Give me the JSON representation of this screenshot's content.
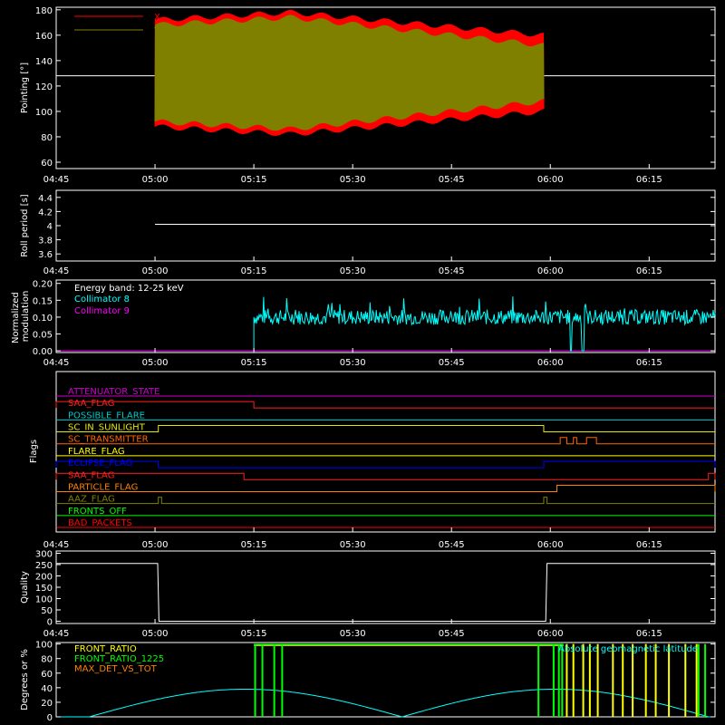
{
  "chart_data": [
    {
      "id": "pointing",
      "type": "line",
      "ylabel": "Pointing [°]",
      "ylim": [
        55,
        182
      ],
      "yticks": [
        60,
        80,
        100,
        120,
        140,
        160,
        180
      ],
      "xticks": [
        "04:45",
        "05:00",
        "05:15",
        "05:30",
        "05:45",
        "06:00",
        "06:15"
      ],
      "xlim_min": [
        -15,
        85
      ],
      "reference_line": 128,
      "series": [
        {
          "name": "X",
          "color": "#ff0000",
          "t_start": 0,
          "t_end": 59,
          "center": 130,
          "amp_start": 42,
          "amp_peak": 48,
          "amp_end": 30
        },
        {
          "name": "Y",
          "color": "#808000",
          "t_start": 0,
          "t_end": 59,
          "center": 130,
          "amp_start": 38,
          "amp_peak": 44,
          "amp_end": 22
        }
      ]
    },
    {
      "id": "roll",
      "type": "line",
      "ylabel": "Roll period [s]",
      "ylim": [
        3.5,
        4.5
      ],
      "yticks": [
        3.6,
        3.8,
        4.0,
        4.2,
        4.4
      ],
      "xticks": [
        "04:45",
        "05:00",
        "05:15",
        "05:30",
        "05:45",
        "06:00",
        "06:15"
      ],
      "series": [
        {
          "name": "",
          "color": "#ffffff",
          "t_start": 0,
          "t_end": 85,
          "value": 4.02
        }
      ]
    },
    {
      "id": "modulation",
      "type": "line",
      "ylabel": "Normalized modulation",
      "ylim": [
        -0.005,
        0.21
      ],
      "yticks": [
        "0.00",
        "0.05",
        "0.10",
        "0.15",
        "0.20"
      ],
      "xticks": [
        "04:45",
        "05:00",
        "05:15",
        "05:30",
        "05:45",
        "06:00",
        "06:15"
      ],
      "energy_band": "Energy band: 12-25 keV",
      "series": [
        {
          "name": "Collimator 8",
          "color": "#00ffff",
          "t_start": 15,
          "t_end": 85,
          "mean": 0.1,
          "gaps": [
            [
              63,
              64.5
            ],
            [
              64.8,
              66
            ]
          ]
        },
        {
          "name": "Collimator 9",
          "color": "#ff00ff",
          "t_start": -15,
          "t_end": 85,
          "value": 0
        }
      ]
    },
    {
      "id": "flags",
      "type": "line",
      "ylabel": "Flags",
      "xticks": [
        "04:45",
        "05:00",
        "05:15",
        "05:30",
        "05:45",
        "06:00",
        "06:15"
      ],
      "flags": [
        {
          "name": "ATTENUATOR_STATE",
          "color": "#cc00cc",
          "on": []
        },
        {
          "name": "SAA_FLAG",
          "color": "#ff2020",
          "on": [
            [
              -15,
              15
            ]
          ]
        },
        {
          "name": "POSSIBLE_FLARE",
          "color": "#00c8c8",
          "on": []
        },
        {
          "name": "SC_IN_SUNLIGHT",
          "color": "#e6e600",
          "on": [
            [
              0.5,
              59
            ]
          ]
        },
        {
          "name": "SC_TRANSMITTER",
          "color": "#ff6600",
          "on": [
            [
              61.5,
              62.5
            ],
            [
              63.5,
              64
            ],
            [
              65.5,
              67
            ]
          ]
        },
        {
          "name": "FLARE_FLAG",
          "color": "#ffff00",
          "on": []
        },
        {
          "name": "ECLIPSE_FLAG",
          "color": "#0000ff",
          "on": [
            [
              -15,
              0.5
            ],
            [
              59,
              85
            ]
          ]
        },
        {
          "name": "SAA_FLAG",
          "color": "#ff2020",
          "on": [
            [
              -15,
              13.5
            ],
            [
              84,
              85
            ]
          ]
        },
        {
          "name": "PARTICLE_FLAG",
          "color": "#ff8000",
          "on": [
            [
              61,
              85
            ]
          ]
        },
        {
          "name": "AAZ_FLAG",
          "color": "#808000",
          "on": [
            [
              0.5,
              1
            ],
            [
              59,
              59.5
            ]
          ]
        },
        {
          "name": "FRONTS_OFF",
          "color": "#00ff00",
          "on": []
        },
        {
          "name": "BAD_PACKETS",
          "color": "#ff0000",
          "on": []
        }
      ]
    },
    {
      "id": "quality",
      "type": "line",
      "ylabel": "Quality",
      "ylim": [
        -10,
        310
      ],
      "yticks": [
        0,
        50,
        100,
        150,
        200,
        250,
        300
      ],
      "xticks": [
        "04:45",
        "05:00",
        "05:15",
        "05:30",
        "05:45",
        "06:00",
        "06:15"
      ],
      "series": [
        {
          "name": "",
          "color": "#ffffff",
          "points": [
            [
              -15,
              255
            ],
            [
              0.4,
              255
            ],
            [
              0.6,
              0
            ],
            [
              59.3,
              0
            ],
            [
              59.5,
              255
            ],
            [
              85,
              255
            ]
          ]
        }
      ]
    },
    {
      "id": "ratios",
      "type": "line",
      "ylabel": "Degrees or %",
      "ylim": [
        0,
        102
      ],
      "yticks": [
        0,
        20,
        40,
        60,
        80,
        100
      ],
      "xticks": [
        "04:45",
        "05:00",
        "05:15",
        "05:30",
        "05:45",
        "06:00",
        "06:15"
      ],
      "series": [
        {
          "name": "FRONT_RATIO",
          "color": "#ffff00"
        },
        {
          "name": "FRONT_RATIO_1225",
          "color": "#00ff00"
        },
        {
          "name": "MAX_DET_VS_TOT",
          "color": "#ff8000"
        },
        {
          "name": "Absolute geomagnetic latitude",
          "color": "#00ffff",
          "min_times": [
            -10,
            37.5,
            84
          ],
          "max": 38
        }
      ],
      "green_spikes": [
        15.2,
        16.3,
        18.1,
        19.3,
        58.2,
        60.5,
        61.3,
        61.8,
        82.5,
        83.5
      ],
      "yellow_spikes": [
        62.5,
        63.5,
        65,
        66,
        67.2,
        69.5,
        71,
        72.5,
        74.5,
        76,
        78,
        80.5,
        82.2
      ]
    }
  ]
}
